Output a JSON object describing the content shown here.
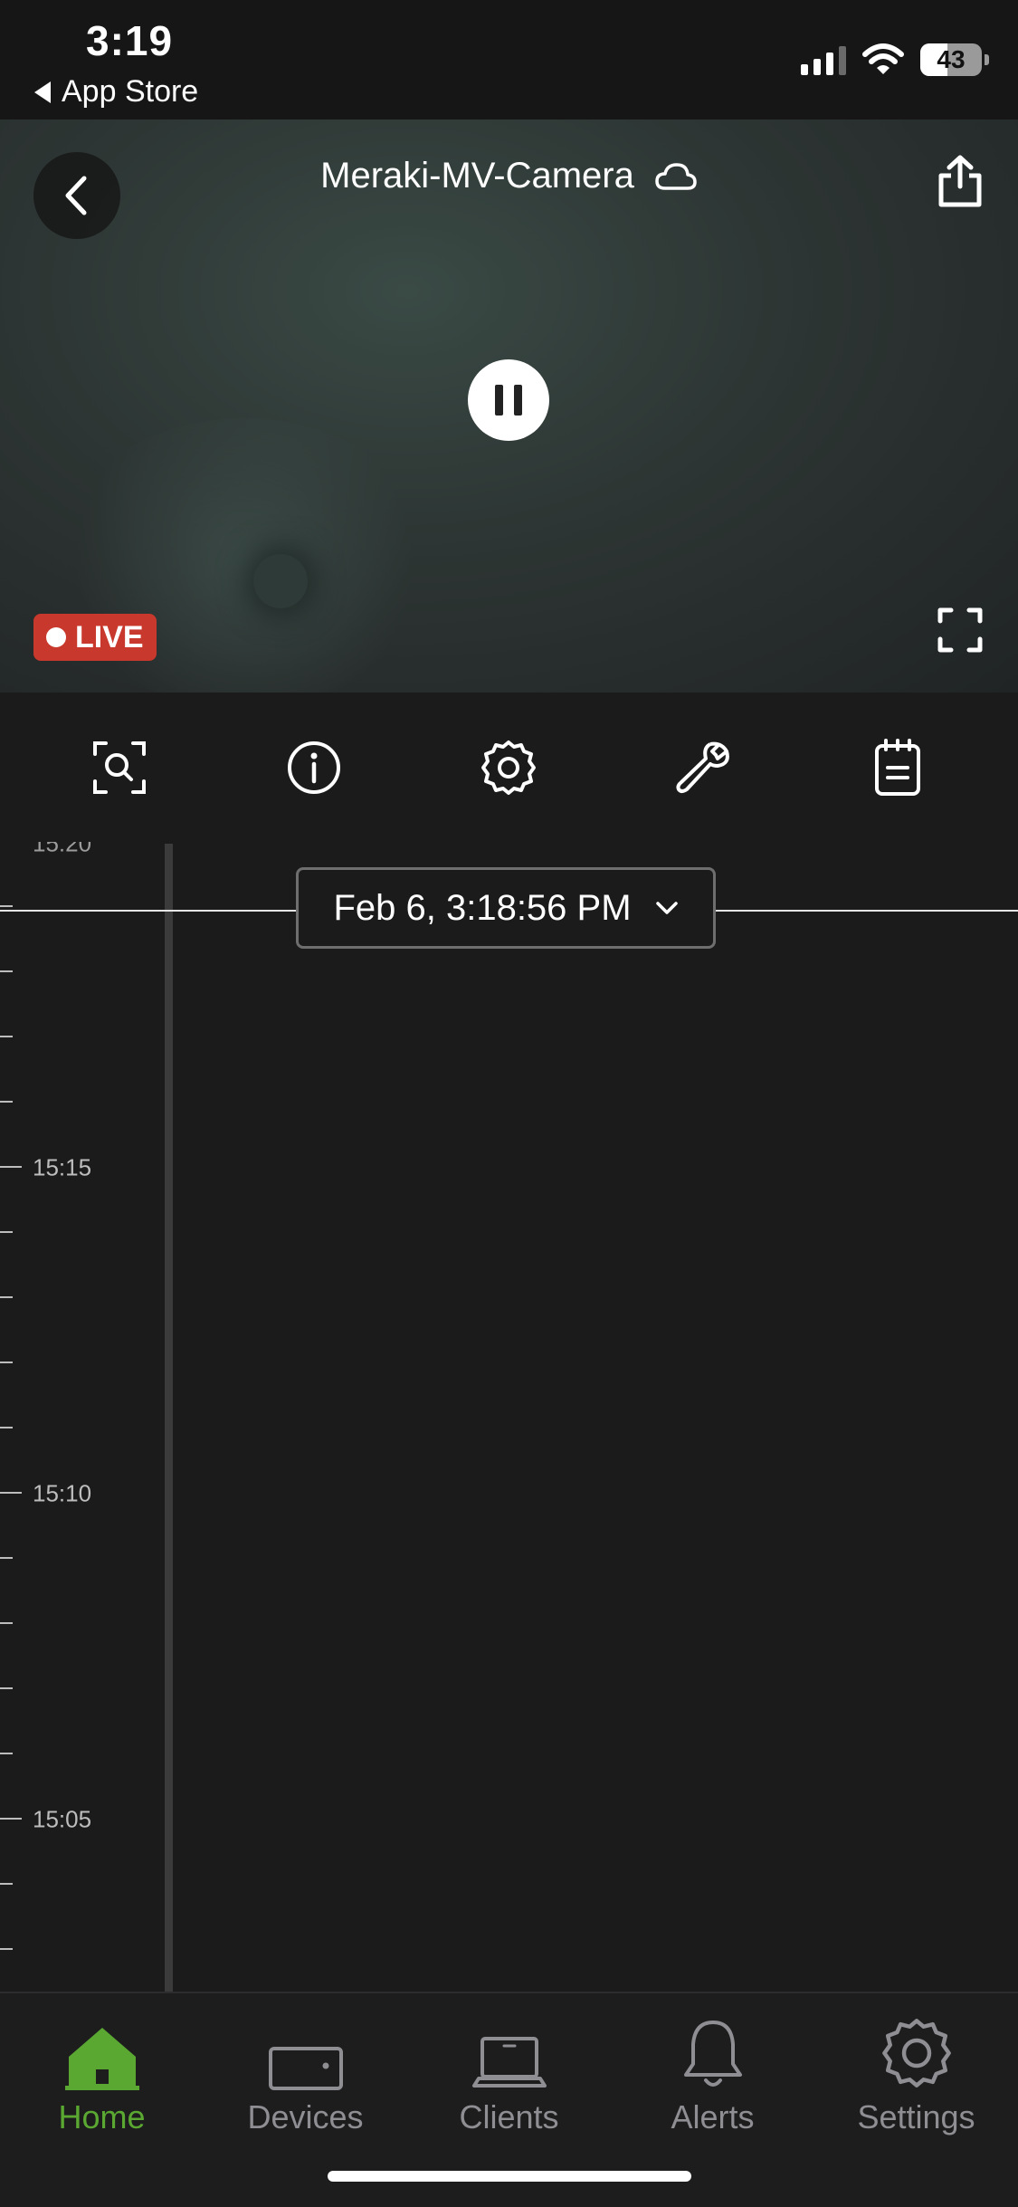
{
  "status_bar": {
    "time": "3:19",
    "back_app": "App Store",
    "battery": "43"
  },
  "camera": {
    "title": "Meraki-MV-Camera",
    "live_label": "LIVE"
  },
  "toolbar": {
    "icons": [
      "zoom-search-icon",
      "info-icon",
      "gear-icon",
      "wrench-icon",
      "notepad-icon"
    ]
  },
  "timeline": {
    "partial_label": "15:20",
    "labels": [
      "15:15",
      "15:10",
      "15:05"
    ],
    "selected_datetime": "Feb 6, 3:18:56 PM"
  },
  "tabs": [
    {
      "label": "Home",
      "icon": "home-icon",
      "active": true
    },
    {
      "label": "Devices",
      "icon": "device-icon",
      "active": false
    },
    {
      "label": "Clients",
      "icon": "laptop-icon",
      "active": false
    },
    {
      "label": "Alerts",
      "icon": "bell-icon",
      "active": false
    },
    {
      "label": "Settings",
      "icon": "settings-gear-icon",
      "active": false
    }
  ],
  "colors": {
    "accent_green": "#5aa832",
    "live_red": "#c8382c",
    "background": "#1b1b1c"
  }
}
